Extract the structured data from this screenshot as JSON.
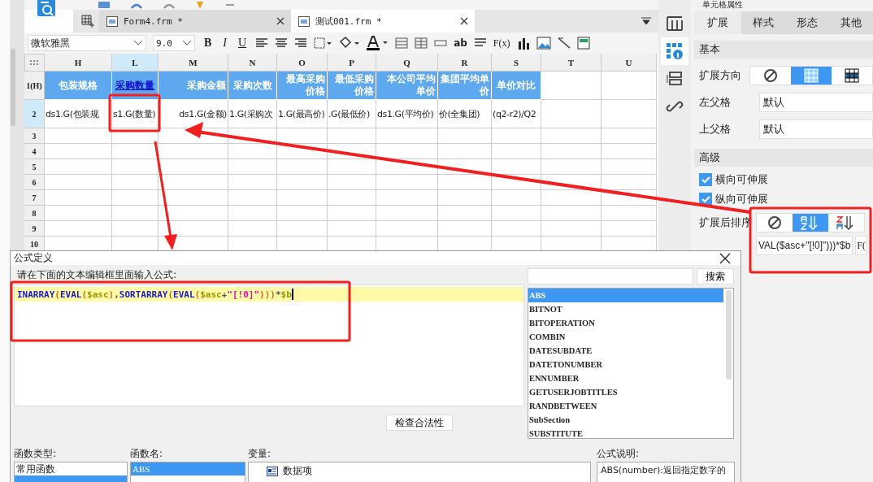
{
  "tabs": [
    {
      "label": "Form4.frm *",
      "selected": false
    },
    {
      "label": "测试001.frm *",
      "selected": true
    }
  ],
  "format_toolbar": {
    "font": "微软雅黑",
    "size": "9.0",
    "text_buttons": [
      {
        "label": "B",
        "kind": "bold"
      },
      {
        "label": "I",
        "kind": "italic"
      },
      {
        "label": "U",
        "kind": "underline"
      }
    ],
    "ab_label": "ab",
    "fx_label": "F(x)"
  },
  "sheet": {
    "columns": [
      {
        "label": "H",
        "selected": false
      },
      {
        "label": "L",
        "selected": true
      },
      {
        "label": "M",
        "selected": false
      },
      {
        "label": "N",
        "selected": false
      },
      {
        "label": "O",
        "selected": false
      },
      {
        "label": "P",
        "selected": false
      },
      {
        "label": "Q",
        "selected": false
      },
      {
        "label": "R",
        "selected": false
      },
      {
        "label": "S",
        "selected": false
      },
      {
        "label": "T",
        "selected": false
      },
      {
        "label": "U",
        "selected": false
      }
    ],
    "rows": [
      {
        "number": "1(H)",
        "kind": "header",
        "cells": [
          {
            "text": "包装规格",
            "link": false
          },
          {
            "text": "采购数量",
            "link": true
          },
          {
            "text": "采购金额",
            "link": false
          },
          {
            "text": "采购次数",
            "link": false
          },
          {
            "text": "最高采购价格",
            "link": false
          },
          {
            "text": "最低采购价格",
            "link": false
          },
          {
            "text": "本公司平均单价",
            "link": false
          },
          {
            "text": "集团平均单价",
            "link": false
          },
          {
            "text": "单价对比",
            "link": false
          }
        ]
      },
      {
        "number": "2",
        "kind": "data",
        "cells": [
          {
            "text": "ds1.G(包装规"
          },
          {
            "text": "s1.G(数量)"
          },
          {
            "text": "ds1.G(金额)"
          },
          {
            "text": "1.G(采购次"
          },
          {
            "text": "1.G(最高价)"
          },
          {
            "text": ".G(最低价)"
          },
          {
            "text": "ds1.G(平均价)"
          },
          {
            "text": "价(全集团)"
          },
          {
            "text": "(q2-r2)/Q2"
          }
        ]
      },
      {
        "number": "3",
        "kind": "empty",
        "cells": []
      },
      {
        "number": "4",
        "kind": "empty",
        "cells": []
      },
      {
        "number": "5",
        "kind": "empty",
        "cells": []
      },
      {
        "number": "6",
        "kind": "empty",
        "cells": []
      },
      {
        "number": "7",
        "kind": "empty",
        "cells": []
      },
      {
        "number": "8",
        "kind": "empty",
        "cells": []
      },
      {
        "number": "9",
        "kind": "empty",
        "cells": []
      },
      {
        "number": "10",
        "kind": "empty",
        "cells": []
      }
    ]
  },
  "property_panel": {
    "title": "单元格属性",
    "tabs": [
      {
        "label": "扩展",
        "selected": true
      },
      {
        "label": "样式",
        "selected": false
      },
      {
        "label": "形态",
        "selected": false
      },
      {
        "label": "其他",
        "selected": false
      }
    ],
    "basic_section": "基本",
    "expand_direction_label": "扩展方向",
    "expand_direction": [
      {
        "kind": "none",
        "selected": false
      },
      {
        "kind": "vertical",
        "selected": true
      },
      {
        "kind": "horizontal",
        "selected": false
      }
    ],
    "left_parent": {
      "label": "左父格",
      "value": "默认"
    },
    "top_parent": {
      "label": "上父格",
      "value": "默认"
    },
    "advanced_section": "高级",
    "checkboxes": [
      {
        "label": "横向可伸展",
        "checked": true
      },
      {
        "label": "纵向可伸展",
        "checked": true
      }
    ],
    "sort_label": "扩展后排序",
    "sort": [
      {
        "kind": "none",
        "selected": false
      },
      {
        "kind": "ascending",
        "selected": true
      },
      {
        "kind": "descending",
        "selected": false
      }
    ],
    "sort_formula": "VAL($asc+\"[!0]\")))*$b",
    "formula_button": "F("
  },
  "dialog": {
    "title": "公式定义",
    "prompt": "请在下面的文本编辑框里面输入公式:",
    "formula": [
      {
        "text": "INARRAY",
        "kind": "function"
      },
      {
        "text": "(",
        "kind": "paren"
      },
      {
        "text": "EVAL",
        "kind": "function"
      },
      {
        "text": "(",
        "kind": "paren"
      },
      {
        "text": "$asc",
        "kind": "variable"
      },
      {
        "text": ")",
        "kind": "paren"
      },
      {
        "text": ",",
        "kind": "operator"
      },
      {
        "text": "SORTARRAY",
        "kind": "function"
      },
      {
        "text": "(",
        "kind": "paren"
      },
      {
        "text": "EVAL",
        "kind": "function"
      },
      {
        "text": "(",
        "kind": "paren"
      },
      {
        "text": "$asc",
        "kind": "variable"
      },
      {
        "text": "+",
        "kind": "operator"
      },
      {
        "text": "\"[!0]\"",
        "kind": "string"
      },
      {
        "text": ")))",
        "kind": "paren"
      },
      {
        "text": "*",
        "kind": "operator"
      },
      {
        "text": "$b",
        "kind": "variable"
      }
    ],
    "search_button": "搜索",
    "functions": [
      {
        "name": "ABS",
        "selected": true
      },
      {
        "name": "BITNOT",
        "selected": false
      },
      {
        "name": "BITOPERATION",
        "selected": false
      },
      {
        "name": "COMBIN",
        "selected": false
      },
      {
        "name": "DATESUBDATE",
        "selected": false
      },
      {
        "name": "DATETONUMBER",
        "selected": false
      },
      {
        "name": "ENNUMBER",
        "selected": false
      },
      {
        "name": "GETUSERJOBTITLES",
        "selected": false
      },
      {
        "name": "RANDBETWEEN",
        "selected": false
      },
      {
        "name": "SubSection",
        "selected": false
      },
      {
        "name": "SUBSTITUTE",
        "selected": false
      }
    ],
    "check_button": "检查合法性",
    "function_type_label": "函数类型:",
    "function_name_label": "函数名:",
    "variable_label": "变量:",
    "description_label": "公式说明:",
    "function_types": [
      {
        "name": "常用函数",
        "selected": false
      },
      {
        "selected": true
      }
    ],
    "function_names": [
      {
        "name": "ABS",
        "selected": true
      }
    ],
    "variables": [
      {
        "name": "数据项"
      }
    ],
    "description": "ABS(number):返回指定数字的"
  }
}
